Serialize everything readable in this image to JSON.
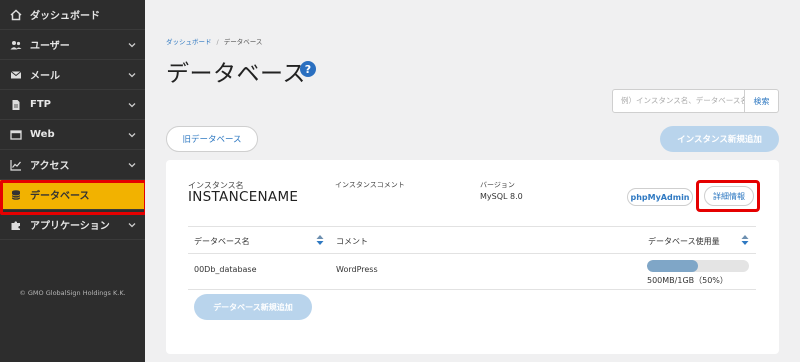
{
  "sidebar": {
    "items": [
      {
        "label": "ダッシュボード",
        "icon": "home-icon",
        "has_chevron": false
      },
      {
        "label": "ユーザー",
        "icon": "users-icon",
        "has_chevron": true
      },
      {
        "label": "メール",
        "icon": "mail-icon",
        "has_chevron": true
      },
      {
        "label": "FTP",
        "icon": "file-icon",
        "has_chevron": true
      },
      {
        "label": "Web",
        "icon": "window-icon",
        "has_chevron": true
      },
      {
        "label": "アクセス",
        "icon": "chart-icon",
        "has_chevron": true
      },
      {
        "label": "データベース",
        "icon": "database-icon",
        "has_chevron": false,
        "active": true
      },
      {
        "label": "アプリケーション",
        "icon": "puzzle-icon",
        "has_chevron": true
      }
    ],
    "copyright": "© GMO GlobalSign Holdings K.K."
  },
  "breadcrumb": {
    "home": "ダッシュボード",
    "separator": "/",
    "current": "データベース"
  },
  "page": {
    "title": "データベース",
    "help_glyph": "?"
  },
  "search": {
    "placeholder": "例）インスタンス名、データベース名",
    "button": "検索"
  },
  "buttons": {
    "old_db": "旧データベース",
    "add_instance": "インスタンス新規追加",
    "add_database": "データベース新規追加"
  },
  "instance": {
    "name_label": "インスタンス名",
    "name": "INSTANCENAME",
    "comment_label": "インスタンスコメント",
    "version_label": "バージョン",
    "version": "MySQL 8.0",
    "phpmyadmin": "phpMyAdmin",
    "detail": "詳細情報"
  },
  "table": {
    "headers": {
      "name": "データベース名",
      "comment": "コメント",
      "usage": "データベース使用量"
    },
    "rows": [
      {
        "name": "00Db_database",
        "comment": "WordPress",
        "usage_text": "500MB/1GB（50%）",
        "usage_fraction": 0.5
      }
    ]
  },
  "colors": {
    "sidebar_bg": "#2d2d2d",
    "active": "#f2b200",
    "accent": "#2f79c2",
    "highlight": "#e50000",
    "disabled_btn": "#b9d4ec"
  }
}
